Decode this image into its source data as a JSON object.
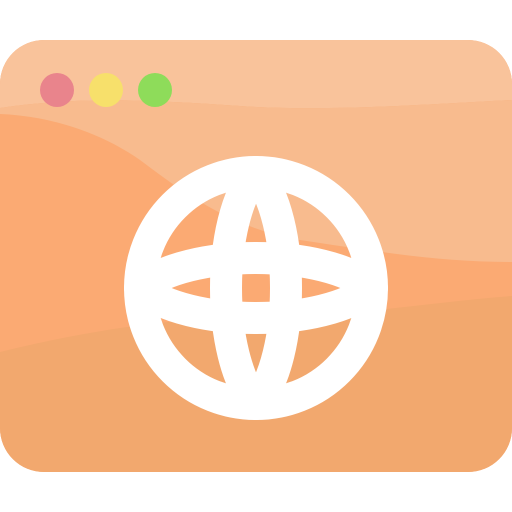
{
  "icon": {
    "name": "browser-globe-icon",
    "window_controls": [
      {
        "name": "close-dot",
        "color": "#E9848C"
      },
      {
        "name": "minimize-dot",
        "color": "#F7E06B"
      },
      {
        "name": "maximize-dot",
        "color": "#8EDC5A"
      }
    ],
    "colors": {
      "window_top": "#F9C39B",
      "window_middle_light": "#F8BB8E",
      "window_middle": "#FBAA73",
      "window_bottom": "#F2A86E",
      "globe": "#FFFFFF"
    }
  }
}
